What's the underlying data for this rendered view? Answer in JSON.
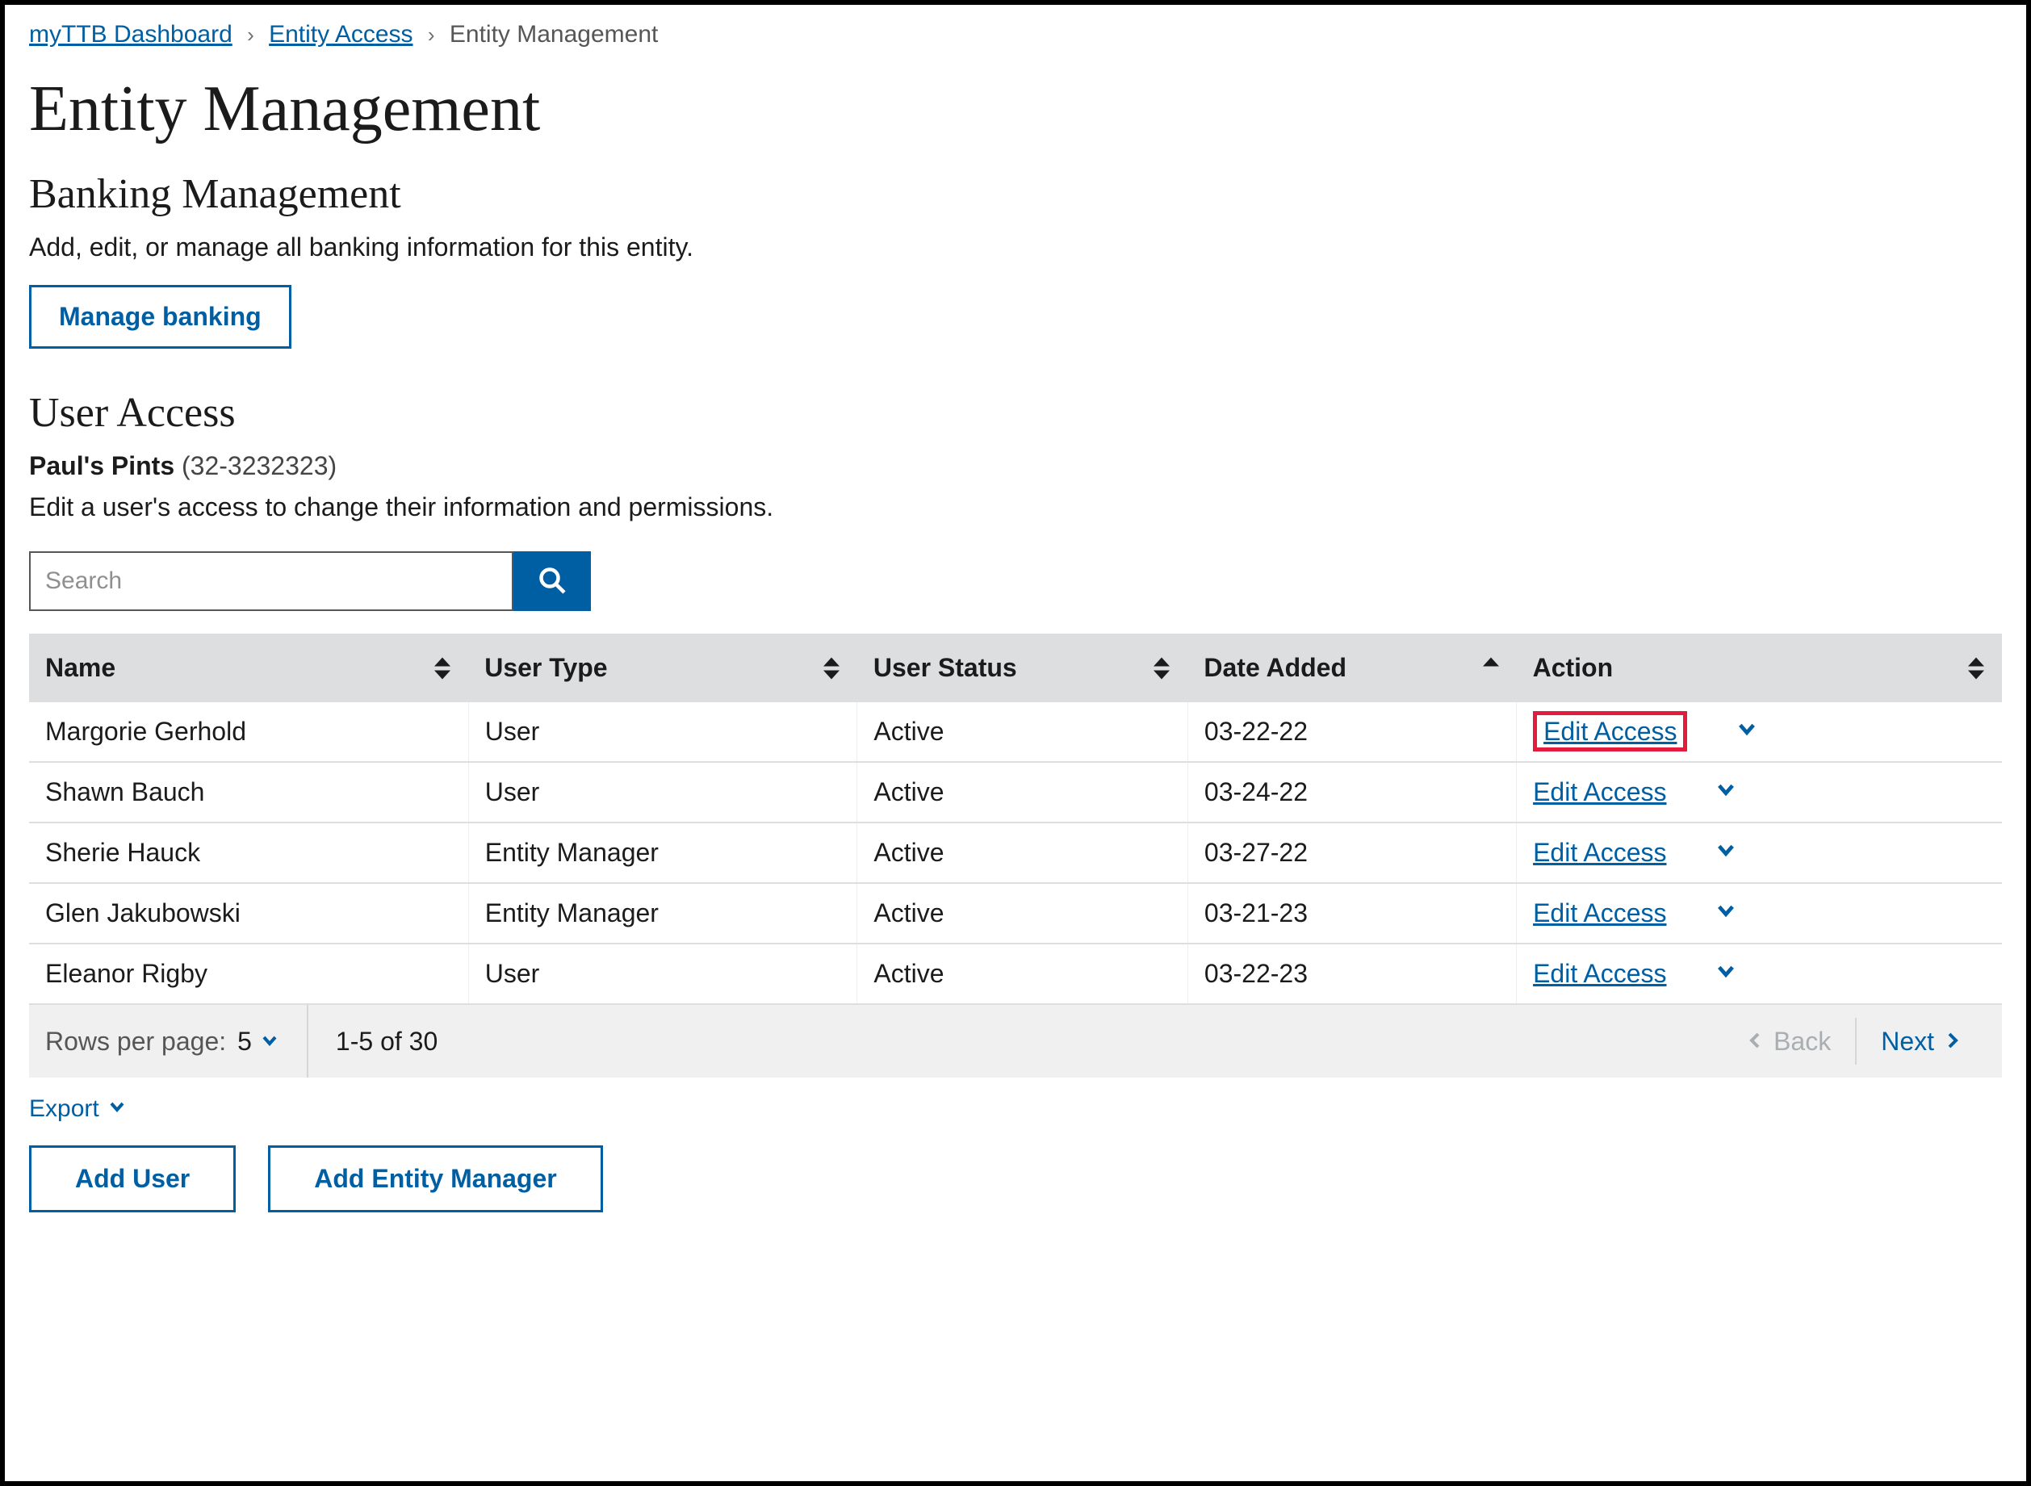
{
  "breadcrumb": {
    "items": [
      {
        "label": "myTTB Dashboard",
        "link": true
      },
      {
        "label": "Entity Access",
        "link": true
      },
      {
        "label": "Entity Management",
        "link": false
      }
    ]
  },
  "page_title": "Entity Management",
  "banking_section": {
    "title": "Banking Management",
    "description": "Add, edit, or manage all banking information for this entity.",
    "button_label": "Manage banking"
  },
  "user_access": {
    "title": "User Access",
    "entity_name": "Paul's Pints",
    "entity_id": "(32-3232323)",
    "description": "Edit a user's access to change their information and permissions."
  },
  "search": {
    "placeholder": "Search"
  },
  "table": {
    "columns": {
      "name": "Name",
      "user_type": "User Type",
      "user_status": "User Status",
      "date_added": "Date Added",
      "action": "Action"
    },
    "action_label": "Edit Access",
    "rows": [
      {
        "name": "Margorie Gerhold",
        "type": "User",
        "status": "Active",
        "date": "03-22-22",
        "highlight": true
      },
      {
        "name": "Shawn Bauch",
        "type": "User",
        "status": "Active",
        "date": "03-24-22",
        "highlight": false
      },
      {
        "name": "Sherie Hauck",
        "type": "Entity Manager",
        "status": "Active",
        "date": "03-27-22",
        "highlight": false
      },
      {
        "name": "Glen Jakubowski",
        "type": "Entity Manager",
        "status": "Active",
        "date": "03-21-23",
        "highlight": false
      },
      {
        "name": "Eleanor Rigby",
        "type": "User",
        "status": "Active",
        "date": "03-22-23",
        "highlight": false
      }
    ],
    "pagination": {
      "rows_per_page_label": "Rows per page:",
      "rows_per_page_value": "5",
      "range_text": "1-5 of 30",
      "back_label": "Back",
      "next_label": "Next"
    }
  },
  "export_label": "Export",
  "buttons": {
    "add_user": "Add User",
    "add_entity_manager": "Add Entity Manager"
  }
}
